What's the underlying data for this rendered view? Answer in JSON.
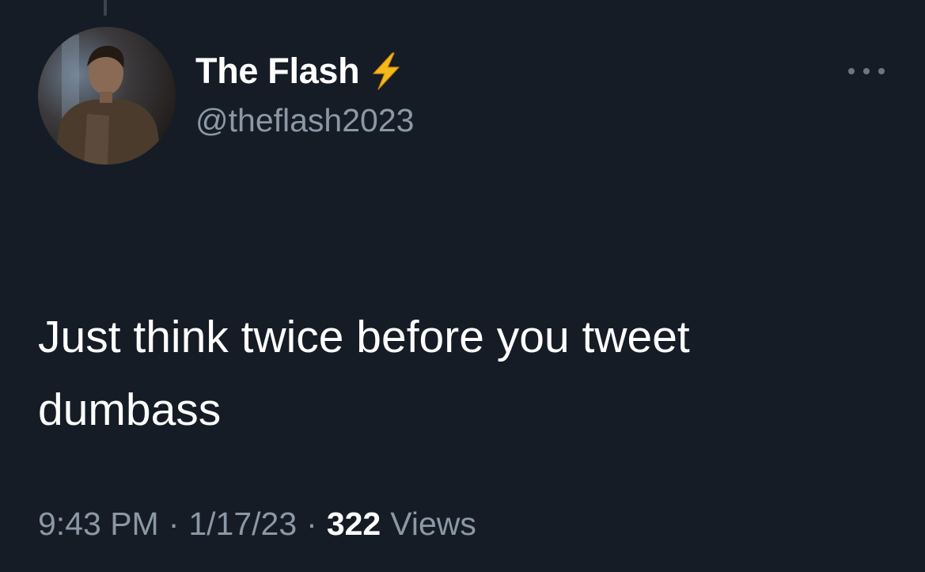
{
  "tweet": {
    "author": {
      "display_name": "The Flash",
      "handle": "@theflash2023",
      "badge_icon": "lightning-bolt-icon",
      "avatar": "profile-photo"
    },
    "text": "Just think twice before you tweet\ndumbass",
    "time": "9:43 PM",
    "separator": "·",
    "date": "1/17/23",
    "views_count": "322",
    "views_label": "Views",
    "more_icon": "more-options-icon"
  },
  "theme": {
    "background": "#161c26",
    "text_primary": "#ffffff",
    "text_secondary": "#8b98a5",
    "bolt_color": "#f5b91c"
  }
}
